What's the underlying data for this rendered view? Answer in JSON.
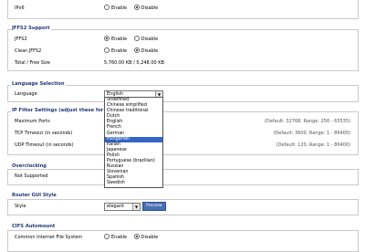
{
  "ipv6": {
    "label": "IPv6",
    "enable": "Enable",
    "disable": "Disable"
  },
  "jffs2": {
    "legend": "JFFS2 Support",
    "jffs2_label": "JFFS2",
    "clean_label": "Clean JFFS2",
    "total_label": "Total / Free Size",
    "total_value": "5,760.00 KB / 5,248.00 KB",
    "enable": "Enable",
    "disable": "Disable"
  },
  "language": {
    "legend": "Language Selection",
    "label": "Language",
    "selected": "English",
    "options": [
      "undefined",
      "Chinese simplified",
      "Chinese traditional",
      "Dutch",
      "English",
      "French",
      "German",
      "Hungarian",
      "Italian",
      "Japanese",
      "Polish",
      "Portuguese (brazilian)",
      "Russian",
      "Slovenian",
      "Spanish",
      "Swedish"
    ],
    "highlighted_index": 7
  },
  "ipfilter": {
    "legend": "IP Filter Settings (adjust these for P",
    "max_ports_label": "Maximum Ports",
    "max_ports_hint": "(Default: 32768, Range: 256 - 65535)",
    "tcp_label": "TCP Timeout (in seconds)",
    "tcp_hint": "(Default: 3600, Range: 1 - 86400)",
    "udp_label": "UDP Timeout (in seconds)",
    "udp_hint": "(Default: 120, Range: 1 - 86400)"
  },
  "overclocking": {
    "legend": "Overclocking",
    "status": "Not Supported"
  },
  "gui_style": {
    "legend": "Router GUI Style",
    "label": "Style",
    "value": "elegant",
    "preview": "Preview"
  },
  "cifs": {
    "legend": "CIFS Automount",
    "label": "Common Internet File System",
    "enable": "Enable",
    "disable": "Disable"
  }
}
